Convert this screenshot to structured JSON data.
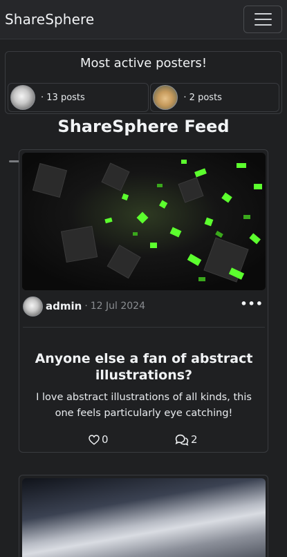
{
  "navbar": {
    "brand": "ShareSphere",
    "menu_icon": "hamburger-menu-icon"
  },
  "active_posters": {
    "title": "Most active posters!",
    "items": [
      {
        "count_text": "· 13 posts",
        "avatar_icon": "user-avatar"
      },
      {
        "count_text": "· 2 posts",
        "avatar_icon": "cat-avatar"
      }
    ]
  },
  "feed": {
    "title": "ShareSphere Feed",
    "posts": [
      {
        "image_icon": "abstract-green-cubes-image",
        "author": "admin",
        "separator": "·",
        "date": "12 Jul 2024",
        "menu_icon": "more-dots-icon",
        "more_label": "•••",
        "title": "Anyone else a fan of abstract illustrations?",
        "body": "I love abstract illustrations of all kinds, this one feels particularly eye catching!",
        "likes": "0",
        "comments": "2"
      },
      {
        "image_icon": "feather-closeup-image"
      }
    ]
  },
  "colors": {
    "background": "#1f2022",
    "navbar": "#26272a",
    "border": "#3a3c40",
    "muted": "#8a8d91",
    "accent_green": "#5cff2e"
  }
}
